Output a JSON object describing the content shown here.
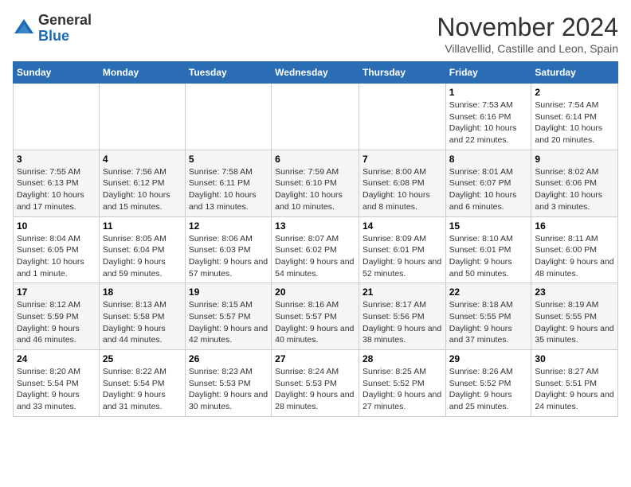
{
  "header": {
    "logo_general": "General",
    "logo_blue": "Blue",
    "month": "November 2024",
    "location": "Villavellid, Castille and Leon, Spain"
  },
  "days_of_week": [
    "Sunday",
    "Monday",
    "Tuesday",
    "Wednesday",
    "Thursday",
    "Friday",
    "Saturday"
  ],
  "weeks": [
    [
      {
        "day": "",
        "info": ""
      },
      {
        "day": "",
        "info": ""
      },
      {
        "day": "",
        "info": ""
      },
      {
        "day": "",
        "info": ""
      },
      {
        "day": "",
        "info": ""
      },
      {
        "day": "1",
        "info": "Sunrise: 7:53 AM\nSunset: 6:16 PM\nDaylight: 10 hours and 22 minutes."
      },
      {
        "day": "2",
        "info": "Sunrise: 7:54 AM\nSunset: 6:14 PM\nDaylight: 10 hours and 20 minutes."
      }
    ],
    [
      {
        "day": "3",
        "info": "Sunrise: 7:55 AM\nSunset: 6:13 PM\nDaylight: 10 hours and 17 minutes."
      },
      {
        "day": "4",
        "info": "Sunrise: 7:56 AM\nSunset: 6:12 PM\nDaylight: 10 hours and 15 minutes."
      },
      {
        "day": "5",
        "info": "Sunrise: 7:58 AM\nSunset: 6:11 PM\nDaylight: 10 hours and 13 minutes."
      },
      {
        "day": "6",
        "info": "Sunrise: 7:59 AM\nSunset: 6:10 PM\nDaylight: 10 hours and 10 minutes."
      },
      {
        "day": "7",
        "info": "Sunrise: 8:00 AM\nSunset: 6:08 PM\nDaylight: 10 hours and 8 minutes."
      },
      {
        "day": "8",
        "info": "Sunrise: 8:01 AM\nSunset: 6:07 PM\nDaylight: 10 hours and 6 minutes."
      },
      {
        "day": "9",
        "info": "Sunrise: 8:02 AM\nSunset: 6:06 PM\nDaylight: 10 hours and 3 minutes."
      }
    ],
    [
      {
        "day": "10",
        "info": "Sunrise: 8:04 AM\nSunset: 6:05 PM\nDaylight: 10 hours and 1 minute."
      },
      {
        "day": "11",
        "info": "Sunrise: 8:05 AM\nSunset: 6:04 PM\nDaylight: 9 hours and 59 minutes."
      },
      {
        "day": "12",
        "info": "Sunrise: 8:06 AM\nSunset: 6:03 PM\nDaylight: 9 hours and 57 minutes."
      },
      {
        "day": "13",
        "info": "Sunrise: 8:07 AM\nSunset: 6:02 PM\nDaylight: 9 hours and 54 minutes."
      },
      {
        "day": "14",
        "info": "Sunrise: 8:09 AM\nSunset: 6:01 PM\nDaylight: 9 hours and 52 minutes."
      },
      {
        "day": "15",
        "info": "Sunrise: 8:10 AM\nSunset: 6:01 PM\nDaylight: 9 hours and 50 minutes."
      },
      {
        "day": "16",
        "info": "Sunrise: 8:11 AM\nSunset: 6:00 PM\nDaylight: 9 hours and 48 minutes."
      }
    ],
    [
      {
        "day": "17",
        "info": "Sunrise: 8:12 AM\nSunset: 5:59 PM\nDaylight: 9 hours and 46 minutes."
      },
      {
        "day": "18",
        "info": "Sunrise: 8:13 AM\nSunset: 5:58 PM\nDaylight: 9 hours and 44 minutes."
      },
      {
        "day": "19",
        "info": "Sunrise: 8:15 AM\nSunset: 5:57 PM\nDaylight: 9 hours and 42 minutes."
      },
      {
        "day": "20",
        "info": "Sunrise: 8:16 AM\nSunset: 5:57 PM\nDaylight: 9 hours and 40 minutes."
      },
      {
        "day": "21",
        "info": "Sunrise: 8:17 AM\nSunset: 5:56 PM\nDaylight: 9 hours and 38 minutes."
      },
      {
        "day": "22",
        "info": "Sunrise: 8:18 AM\nSunset: 5:55 PM\nDaylight: 9 hours and 37 minutes."
      },
      {
        "day": "23",
        "info": "Sunrise: 8:19 AM\nSunset: 5:55 PM\nDaylight: 9 hours and 35 minutes."
      }
    ],
    [
      {
        "day": "24",
        "info": "Sunrise: 8:20 AM\nSunset: 5:54 PM\nDaylight: 9 hours and 33 minutes."
      },
      {
        "day": "25",
        "info": "Sunrise: 8:22 AM\nSunset: 5:54 PM\nDaylight: 9 hours and 31 minutes."
      },
      {
        "day": "26",
        "info": "Sunrise: 8:23 AM\nSunset: 5:53 PM\nDaylight: 9 hours and 30 minutes."
      },
      {
        "day": "27",
        "info": "Sunrise: 8:24 AM\nSunset: 5:53 PM\nDaylight: 9 hours and 28 minutes."
      },
      {
        "day": "28",
        "info": "Sunrise: 8:25 AM\nSunset: 5:52 PM\nDaylight: 9 hours and 27 minutes."
      },
      {
        "day": "29",
        "info": "Sunrise: 8:26 AM\nSunset: 5:52 PM\nDaylight: 9 hours and 25 minutes."
      },
      {
        "day": "30",
        "info": "Sunrise: 8:27 AM\nSunset: 5:51 PM\nDaylight: 9 hours and 24 minutes."
      }
    ]
  ]
}
